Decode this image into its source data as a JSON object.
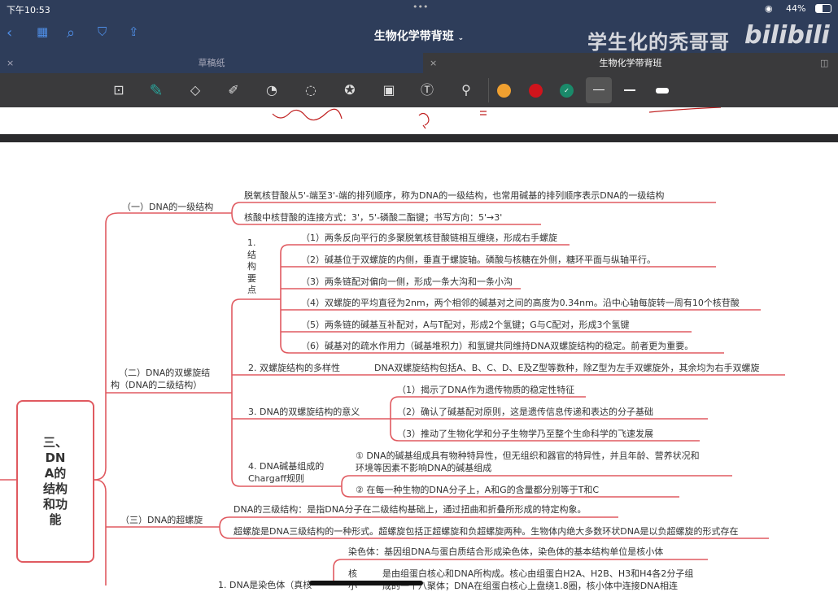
{
  "status_bar": {
    "time": "下午10:53",
    "battery": "44%",
    "dots": "•••"
  },
  "nav": {
    "title": "生物化学带背班",
    "watermark": "学生化的秃哥哥",
    "watermark_logo": "bilibili"
  },
  "tabs": [
    {
      "label": "草稿纸",
      "close": "×"
    },
    {
      "label": "生物化学带背班",
      "close": "×"
    }
  ],
  "toolbar": {
    "tools": [
      "zoom-icon",
      "pen-icon",
      "eraser-icon",
      "highlighter-icon",
      "shapes-icon",
      "lasso-icon",
      "sticker-icon",
      "image-icon",
      "text-icon",
      "laser-icon"
    ],
    "colors": [
      "#f0a030",
      "#d0141c",
      "#1a8a6a"
    ],
    "selected_color": "#1a8a6a"
  },
  "mindmap": {
    "root": "三、DNA的结构和功能",
    "b1": {
      "label": "（一）DNA的一级结构",
      "items": [
        "脱氧核苷酸从5'-端至3'-端的排列顺序，称为DNA的一级结构，也常用碱基的排列顺序表示DNA的一级结构",
        "核酸中核苷酸的连接方式：3'，5'-磷酸二酯键；书写方向：5'→3'"
      ]
    },
    "b2": {
      "label1": "（二）DNA的双螺旋结",
      "label2": "构（DNA的二级结构）",
      "s1": {
        "label": "1.结构要点",
        "items": [
          "（1）两条反向平行的多聚脱氧核苷酸链相互缠绕，形成右手螺旋",
          "（2）碱基位于双螺旋的内侧，垂直于螺旋轴。磷酸与核糖在外侧，糖环平面与纵轴平行。",
          "（3）两条链配对偏向一侧，形成一条大沟和一条小沟",
          "（4）双螺旋的平均直径为2nm，两个相邻的碱基对之间的高度为0.34nm。沿中心轴每旋转一周有10个核苷酸",
          "（5）两条链的碱基互补配对，A与T配对，形成2个氢键；G与C配对，形成3个氢键",
          "（6）碱基对的疏水作用力（碱基堆积力）和氢键共同维持DNA双螺旋结构的稳定。前者更为重要。"
        ]
      },
      "s2": {
        "label": "2. 双螺旋结构的多样性",
        "item": "DNA双螺旋结构包括A、B、C、D、E及Z型等数种，除Z型为左手双螺旋外，其余均为右手双螺旋"
      },
      "s3": {
        "label": "3. DNA的双螺旋结构的意义",
        "items": [
          "（1）揭示了DNA作为遗传物质的稳定性特征",
          "（2）确认了碱基配对原则，这是遗传信息传递和表达的分子基础",
          "（3）推动了生物化学和分子生物学乃至整个生命科学的飞速发展"
        ]
      },
      "s4": {
        "label1": "4. DNA碱基组成的",
        "label2": "Chargaff规则",
        "i1a": "① DNA的碱基组成具有物种特异性，但无组织和器官的特异性，并且年龄、营养状况和",
        "i1b": "环境等因素不影响DNA的碱基组成",
        "i2": "② 在每一种生物的DNA分子上，A和G的含量都分别等于T和C"
      }
    },
    "b3": {
      "label": "（三）DNA的超螺旋",
      "items": [
        "DNA的三级结构：是指DNA分子在二级结构基础上，通过扭曲和折叠所形成的特定构象。",
        "超螺旋是DNA三级结构的一种形式。超螺旋包括正超螺旋和负超螺旋两种。生物体内绝大多数环状DNA是以负超螺旋的形式存在"
      ]
    },
    "b4": {
      "label": "1. DNA是染色体（真核",
      "item1": "染色体：基因组DNA与蛋白质结合形成染色体，染色体的基本结构单位是核小体",
      "nuc_label": "核",
      "nuc_label2": "小",
      "nuc1": "是由组蛋白核心和DNA所构成。核心由组蛋白H2A、H2B、H3和H4各2分子组",
      "nuc2": "成的一个八聚体；DNA在组蛋白核心上盘绕1.8圈，核小体中连接DNA相连"
    }
  },
  "colors": {
    "branch": "#e05a60",
    "chrome": "#2e3d5a",
    "toolbar": "#3a3a3c"
  }
}
